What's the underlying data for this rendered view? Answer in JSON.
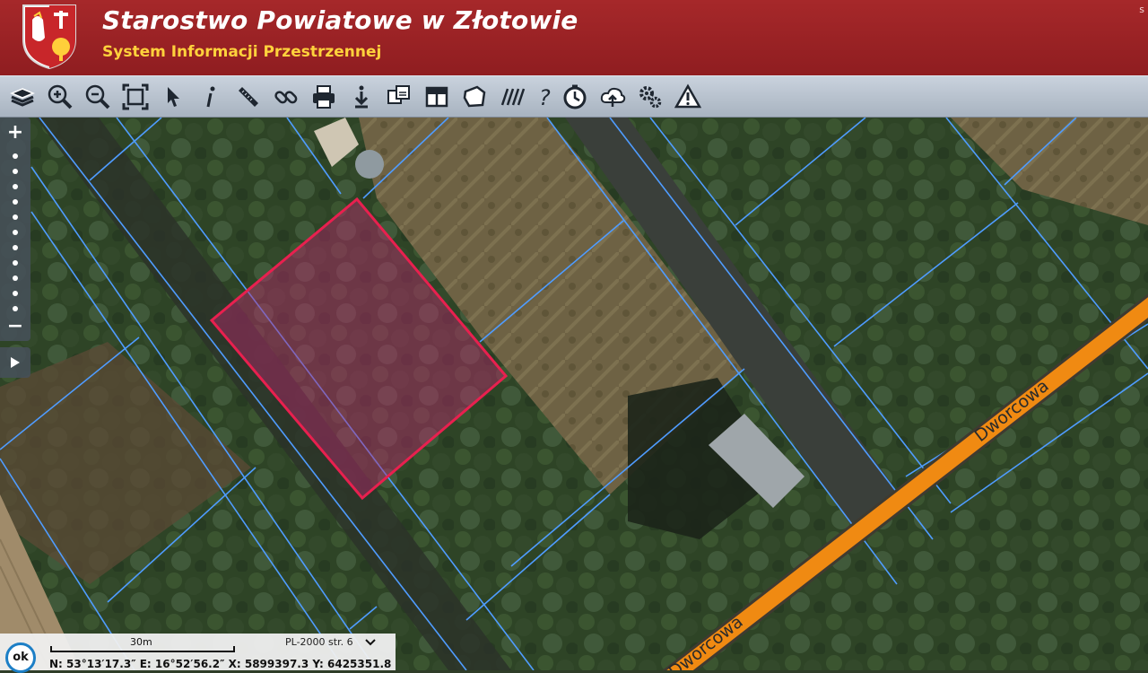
{
  "header": {
    "title": "Starostwo Powiatowe w Złotowie",
    "subtitle": "System Informacji Przestrzennej",
    "corner_text": "s",
    "colors": {
      "bar": "#9b2224",
      "title": "#ffffff",
      "subtitle": "#ffd23c"
    }
  },
  "toolbar": {
    "tools": [
      {
        "icon": "layers-icon"
      },
      {
        "icon": "zoom-in-icon"
      },
      {
        "icon": "zoom-out-icon"
      },
      {
        "icon": "zoom-extent-icon"
      },
      {
        "icon": "select-pointer-icon"
      },
      {
        "icon": "info-icon"
      },
      {
        "icon": "measure-ruler-icon"
      },
      {
        "icon": "link-icon"
      },
      {
        "icon": "print-icon"
      },
      {
        "icon": "download-icon"
      },
      {
        "icon": "compare-maps-icon"
      },
      {
        "icon": "layout-icon"
      },
      {
        "icon": "parcel-shape-icon"
      },
      {
        "icon": "hatch-icon"
      },
      {
        "icon": "help-icon"
      },
      {
        "icon": "history-clock-icon"
      },
      {
        "icon": "cloud-upload-icon"
      },
      {
        "icon": "settings-gears-icon"
      },
      {
        "icon": "warning-triangle-icon"
      }
    ]
  },
  "map": {
    "road_name": "Dworcowa",
    "colors": {
      "parcel_lines": "#4f9cff",
      "selected_parcel": "#e8204f",
      "road": "#f08a12"
    }
  },
  "zoom": {
    "plus": "+",
    "minus": "−"
  },
  "status": {
    "ok_label": "ok",
    "scale_text": "30m",
    "crs": "PL-2000 str. 6",
    "coordinates": "N: 53°13′17.3″  E: 16°52′56.2″  X: 5899397.3  Y: 6425351.8"
  }
}
